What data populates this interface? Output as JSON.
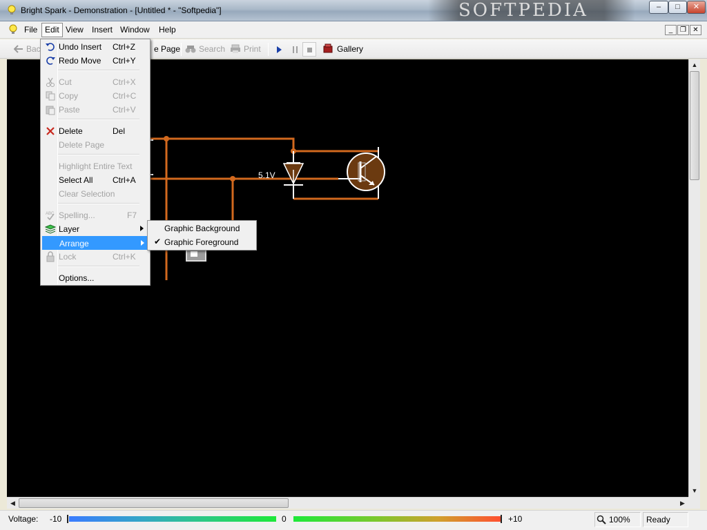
{
  "window": {
    "title": "Bright Spark - Demonstration - [Untitled * - \"Softpedia\"]",
    "watermark": "SOFTPEDIA",
    "minimize_glyph": "–",
    "maximize_glyph": "□",
    "close_glyph": "✕"
  },
  "menubar": {
    "items": [
      "File",
      "Edit",
      "View",
      "Insert",
      "Window",
      "Help"
    ],
    "active": "Edit",
    "mdi_min": "_",
    "mdi_restore": "❐",
    "mdi_close": "✕"
  },
  "toolbar": {
    "back": "Bac",
    "page": "e Page",
    "search": "Search",
    "print": "Print",
    "gallery": "Gallery"
  },
  "edit_menu": {
    "items": [
      {
        "label": "Undo Insert",
        "shortcut": "Ctrl+Z",
        "enabled": true
      },
      {
        "label": "Redo Move",
        "shortcut": "Ctrl+Y",
        "enabled": true
      },
      {
        "label": "Cut",
        "shortcut": "Ctrl+X",
        "enabled": false
      },
      {
        "label": "Copy",
        "shortcut": "Ctrl+C",
        "enabled": false
      },
      {
        "label": "Paste",
        "shortcut": "Ctrl+V",
        "enabled": false
      },
      {
        "label": "Delete",
        "shortcut": "Del",
        "enabled": true
      },
      {
        "label": "Delete Page",
        "shortcut": "",
        "enabled": false
      },
      {
        "label": "Highlight Entire Text",
        "shortcut": "",
        "enabled": false
      },
      {
        "label": "Select All",
        "shortcut": "Ctrl+A",
        "enabled": true
      },
      {
        "label": "Clear Selection",
        "shortcut": "",
        "enabled": false
      },
      {
        "label": "Spelling...",
        "shortcut": "F7",
        "enabled": false
      },
      {
        "label": "Layer",
        "shortcut": "",
        "enabled": true,
        "submenu": true
      },
      {
        "label": "Arrange",
        "shortcut": "",
        "enabled": true,
        "submenu": true,
        "highlighted": true
      },
      {
        "label": "Lock",
        "shortcut": "Ctrl+K",
        "enabled": false
      },
      {
        "label": "Options...",
        "shortcut": "",
        "enabled": true
      }
    ]
  },
  "arrange_submenu": {
    "items": [
      {
        "label": "Graphic Background",
        "checked": false
      },
      {
        "label": "Graphic Foreground",
        "checked": true
      }
    ],
    "check_glyph": "✔"
  },
  "canvas": {
    "component_label": "5.1V",
    "wire_color": "#d2691e",
    "transistor_fill": "#6b3a10"
  },
  "statusbar": {
    "voltage_label": "Voltage:",
    "min": "-10",
    "zero": "0",
    "max": "+10",
    "zoom": "100%",
    "status": "Ready"
  },
  "colors": {
    "menu_highlight": "#3399ff",
    "canvas_bg": "#000000"
  }
}
